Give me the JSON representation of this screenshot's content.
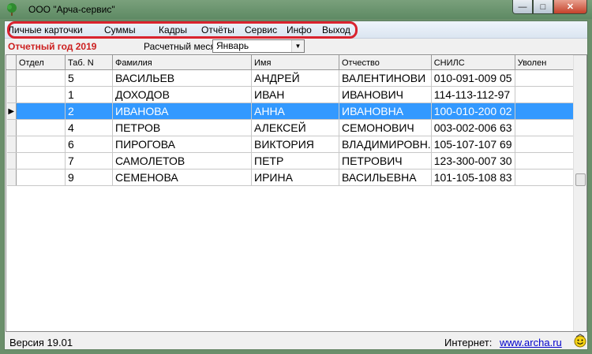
{
  "window": {
    "title": "ООО \"Арча-сервис\"",
    "icon": "tree-icon",
    "controls": {
      "minimize": "minimize-icon",
      "maximize": "maximize-icon",
      "close": "close-icon"
    }
  },
  "menu": {
    "items": [
      "Личные карточки",
      "Суммы",
      "Кадры",
      "Отчёты",
      "Сервис",
      "Инфо",
      "Выход"
    ],
    "highlight_color": "#d9232f"
  },
  "toolbar": {
    "year_label": "Отчетный год 2019",
    "year_color": "#cc1f1f",
    "month_label": "Расчетный месяц",
    "month_value": "Январь"
  },
  "grid": {
    "columns": [
      "Отдел",
      "Таб. N",
      "Фамилия",
      "Имя",
      "Отчество",
      "СНИЛС",
      "Уволен"
    ],
    "selected_index": 2,
    "selection_color": "#3399ff",
    "rows": [
      {
        "dept": "",
        "tab": "5",
        "last": "ВАСИЛЬЕВ",
        "first": "АНДРЕЙ",
        "middle": "ВАЛЕНТИНОВИ",
        "snils": "010-091-009 05",
        "fired": ""
      },
      {
        "dept": "",
        "tab": "1",
        "last": "ДОХОДОВ",
        "first": "ИВАН",
        "middle": "ИВАНОВИЧ",
        "snils": "114-113-112-97",
        "fired": ""
      },
      {
        "dept": "",
        "tab": "2",
        "last": "ИВАНОВА",
        "first": "АННА",
        "middle": "ИВАНОВНА",
        "snils": "100-010-200 02",
        "fired": ""
      },
      {
        "dept": "",
        "tab": "4",
        "last": "ПЕТРОВ",
        "first": "АЛЕКСЕЙ",
        "middle": "СЕМОНОВИЧ",
        "snils": "003-002-006 63",
        "fired": ""
      },
      {
        "dept": "",
        "tab": "6",
        "last": "ПИРОГОВА",
        "first": "ВИКТОРИЯ",
        "middle": "ВЛАДИМИРОВН.",
        "snils": "105-107-107 69",
        "fired": ""
      },
      {
        "dept": "",
        "tab": "7",
        "last": "САМОЛЕТОВ",
        "first": "ПЕТР",
        "middle": "ПЕТРОВИЧ",
        "snils": "123-300-007 30",
        "fired": ""
      },
      {
        "dept": "",
        "tab": "9",
        "last": "СЕМЕНОВА",
        "first": "ИРИНА",
        "middle": "ВАСИЛЬЕВНА",
        "snils": "101-105-108 83",
        "fired": ""
      }
    ]
  },
  "status": {
    "version": "Версия 19.01",
    "internet_label": "Интернет:",
    "internet_link": "www.archa.ru",
    "smiley_icon": "smiley-icon"
  }
}
